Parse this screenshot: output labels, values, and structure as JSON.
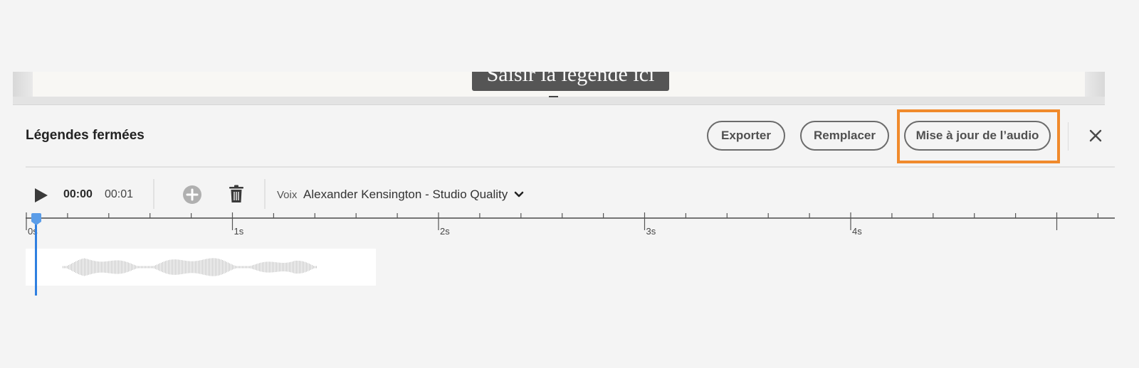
{
  "preview": {
    "caption_text": "Saisir la légende ici"
  },
  "panel": {
    "title": "Légendes fermées",
    "buttons": {
      "export": "Exporter",
      "replace": "Remplacer",
      "update_audio": "Mise à jour de l’audio"
    },
    "highlight_color": "#f08a2c",
    "close_icon": "close-icon"
  },
  "toolbar": {
    "current_time": "00:00",
    "total_time": "00:01",
    "play_icon": "play-icon",
    "add_icon": "add-circle-icon",
    "delete_icon": "trash-icon",
    "voice_label": "Voix",
    "voice_value": "Alexander Kensington - Studio Quality",
    "voice_dropdown_icon": "chevron-down-icon"
  },
  "timeline": {
    "ticks": [
      "0s",
      "1s",
      "2s",
      "3s",
      "4s"
    ],
    "playhead_time": "0s",
    "playhead_color": "#2f7fe0"
  }
}
